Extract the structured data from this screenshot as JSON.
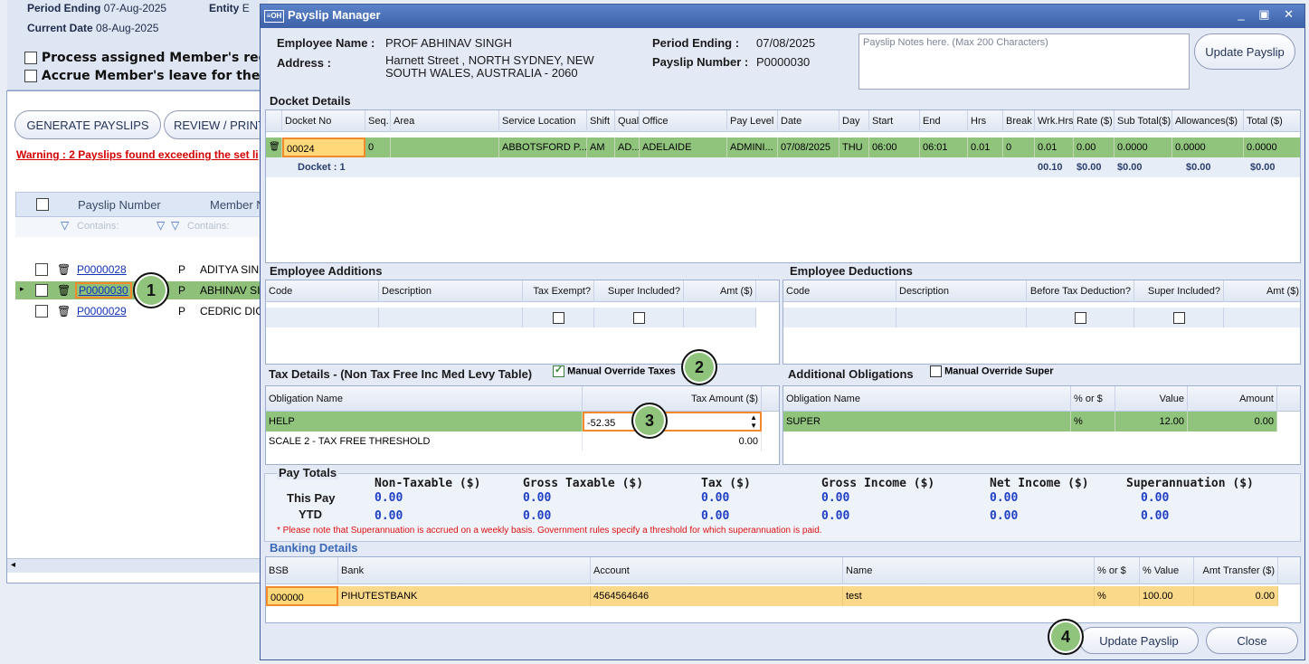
{
  "background": {
    "period_ending_label": "Period Ending",
    "period_ending_value": "07-Aug-2025",
    "entity_label": "Entity",
    "entity_value": "E",
    "current_date_label": "Current Date",
    "current_date_value": "08-Aug-2025",
    "process_checkbox_label": "Process assigned Member's requ",
    "accrue_checkbox_label": "Accrue Member's leave for the c",
    "generate_button": "GENERATE PAYSLIPS",
    "review_button": "REVIEW / PRINT",
    "warning": "Warning : 2 Payslips found exceeding the set li",
    "grid_headers": {
      "payslip_number": "Payslip Number",
      "member_name": "Member Na"
    },
    "filter_placeholder": "Contains:",
    "filter_placeholder_2": "Contains:",
    "rows": [
      {
        "number": "P0000028",
        "type": "P",
        "member": "ADITYA SIN"
      },
      {
        "number": "P0000030",
        "type": "P",
        "member": "ABHINAV SI"
      },
      {
        "number": "P0000029",
        "type": "P",
        "member": "CEDRIC DIG"
      }
    ]
  },
  "dialog": {
    "title": "Payslip Manager",
    "logo": "≡OH",
    "window_controls": "_ ▣ ✕",
    "employee_name_label": "Employee Name :",
    "employee_name": "PROF ABHINAV SINGH",
    "address_label": "Address :",
    "address_line1": "Harnett Street , NORTH SYDNEY, NEW",
    "address_line2": "SOUTH WALES, AUSTRALIA - 2060",
    "period_ending_label": "Period Ending :",
    "period_ending": "07/08/2025",
    "payslip_number_label": "Payslip Number :",
    "payslip_number": "P0000030",
    "notes_placeholder": "Payslip Notes here. (Max 200 Characters)",
    "update_payslip_top": "Update   Payslip",
    "docket_title": "Docket Details",
    "docket_headers": [
      "Docket No",
      "Seq.",
      "Area",
      "Service Location",
      "Shift",
      "Qual",
      "Office",
      "Pay Level",
      "Date",
      "Day",
      "Start",
      "End",
      "Hrs",
      "Break",
      "Wrk.Hrs",
      "Rate ($)",
      "Sub Total($)",
      "Allowances($)",
      "Total ($)"
    ],
    "docket_row": [
      "00024",
      "0",
      "",
      "ABBOTSFORD P...",
      "AM",
      "AD...",
      "ADELAIDE",
      "ADMINI...",
      "07/08/2025",
      "THU",
      "06:00",
      "06:01",
      "0.01",
      "0",
      "0.01",
      "0.00",
      "0.0000",
      "0.0000",
      "0.0000"
    ],
    "docket_summary": {
      "label": "Docket : 1",
      "wrk_hrs": "00.10",
      "rate": "$0.00",
      "sub_total": "$0.00",
      "allowances": "$0.00",
      "total": "$0.00"
    },
    "additions_title": "Employee Additions",
    "additions_headers": [
      "Code",
      "Description",
      "Tax Exempt?",
      "Super Included?",
      "Amt ($)"
    ],
    "deductions_title": "Employee Deductions",
    "deductions_headers": [
      "Code",
      "Description",
      "Before Tax Deduction?",
      "Super Included?",
      "Amt ($)"
    ],
    "tax_title": "Tax Details - (Non Tax Free Inc Med Levy Table)",
    "manual_override_taxes": "Manual Override Taxes",
    "tax_headers": [
      "Obligation Name",
      "Tax Amount ($)"
    ],
    "tax_rows": [
      {
        "name": "HELP",
        "amount": "-52.35"
      },
      {
        "name": "SCALE 2 - TAX FREE THRESHOLD",
        "amount": "0.00"
      }
    ],
    "obligations_title": "Additional Obligations",
    "manual_override_super": "Manual Override Super",
    "obligation_headers": [
      "Obligation Name",
      "% or $",
      "Value",
      "Amount"
    ],
    "obligation_row": {
      "name": "SUPER",
      "type": "%",
      "value": "12.00",
      "amount": "0.00"
    },
    "pay_totals_title": "Pay Totals",
    "totals_headers": [
      "Non-Taxable ($)",
      "Gross Taxable ($)",
      "Tax ($)",
      "Gross Income ($)",
      "Net Income ($)",
      "Superannuation ($)"
    ],
    "this_pay_label": "This Pay",
    "ytd_label": "YTD",
    "this_pay_values": [
      "0.00",
      "0.00",
      "0.00",
      "0.00",
      "0.00",
      "0.00"
    ],
    "ytd_values": [
      "0.00",
      "0.00",
      "0.00",
      "0.00",
      "0.00",
      "0.00"
    ],
    "super_note": "* Please note that Superannuation is accrued on a weekly basis. Government  rules specify a threshold for which superannuation is paid.",
    "banking_title": "Banking Details",
    "banking_headers": [
      "BSB",
      "Bank",
      "Account",
      "Name",
      "% or $",
      "% Value",
      "Amt Transfer ($)"
    ],
    "banking_row": [
      "000000",
      "PIHUTESTBANK",
      "4564564646",
      "test",
      "%",
      "100.00",
      "0.00"
    ],
    "update_payslip_button": "Update Payslip",
    "close_button": "Close"
  },
  "badges": [
    "1",
    "2",
    "3",
    "4"
  ],
  "colors": {
    "selected_row": "#90c47d",
    "bank_row": "#fbd98a",
    "focus_border": "#f28a2b",
    "title_bar": "#3c61a8",
    "totals_value": "#1f3fc4",
    "warning": "#d40000"
  }
}
